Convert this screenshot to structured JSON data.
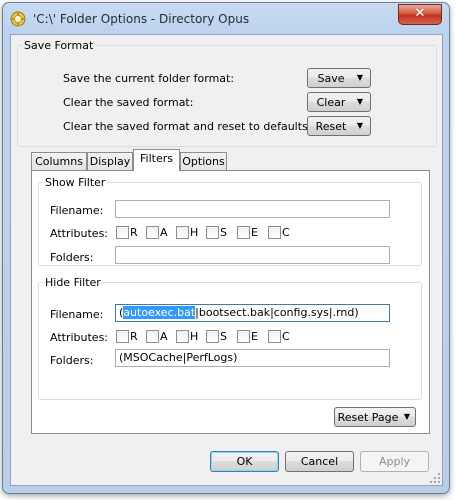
{
  "window": {
    "title": "'C:\\' Folder Options - Directory Opus",
    "close_glyph": "✕"
  },
  "save_format": {
    "heading": "Save Format",
    "rows": [
      {
        "label": "Save the current folder format:",
        "button": "Save"
      },
      {
        "label": "Clear the saved format:",
        "button": "Clear"
      },
      {
        "label": "Clear the saved format and reset to defaults:",
        "button": "Reset"
      }
    ]
  },
  "tabs": [
    {
      "label": "Columns",
      "active": false
    },
    {
      "label": "Display",
      "active": false
    },
    {
      "label": "Filters",
      "active": true
    },
    {
      "label": "Options",
      "active": false
    }
  ],
  "show_filter": {
    "heading": "Show Filter",
    "filename_label": "Filename:",
    "filename_value": "",
    "attributes_label": "Attributes:",
    "folders_label": "Folders:",
    "folders_value": ""
  },
  "hide_filter": {
    "heading": "Hide Filter",
    "filename_label": "Filename:",
    "filename_prefix": "(",
    "filename_selected": "autoexec.bat",
    "filename_rest": "|bootsect.bak|config.sys|.rnd)",
    "attributes_label": "Attributes:",
    "folders_label": "Folders:",
    "folders_value": "(MSOCache|PerfLogs)"
  },
  "attributes": [
    "R",
    "A",
    "H",
    "S",
    "E",
    "C"
  ],
  "reset_page_button": "Reset Page",
  "footer": {
    "ok": "OK",
    "cancel": "Cancel",
    "apply": "Apply"
  }
}
